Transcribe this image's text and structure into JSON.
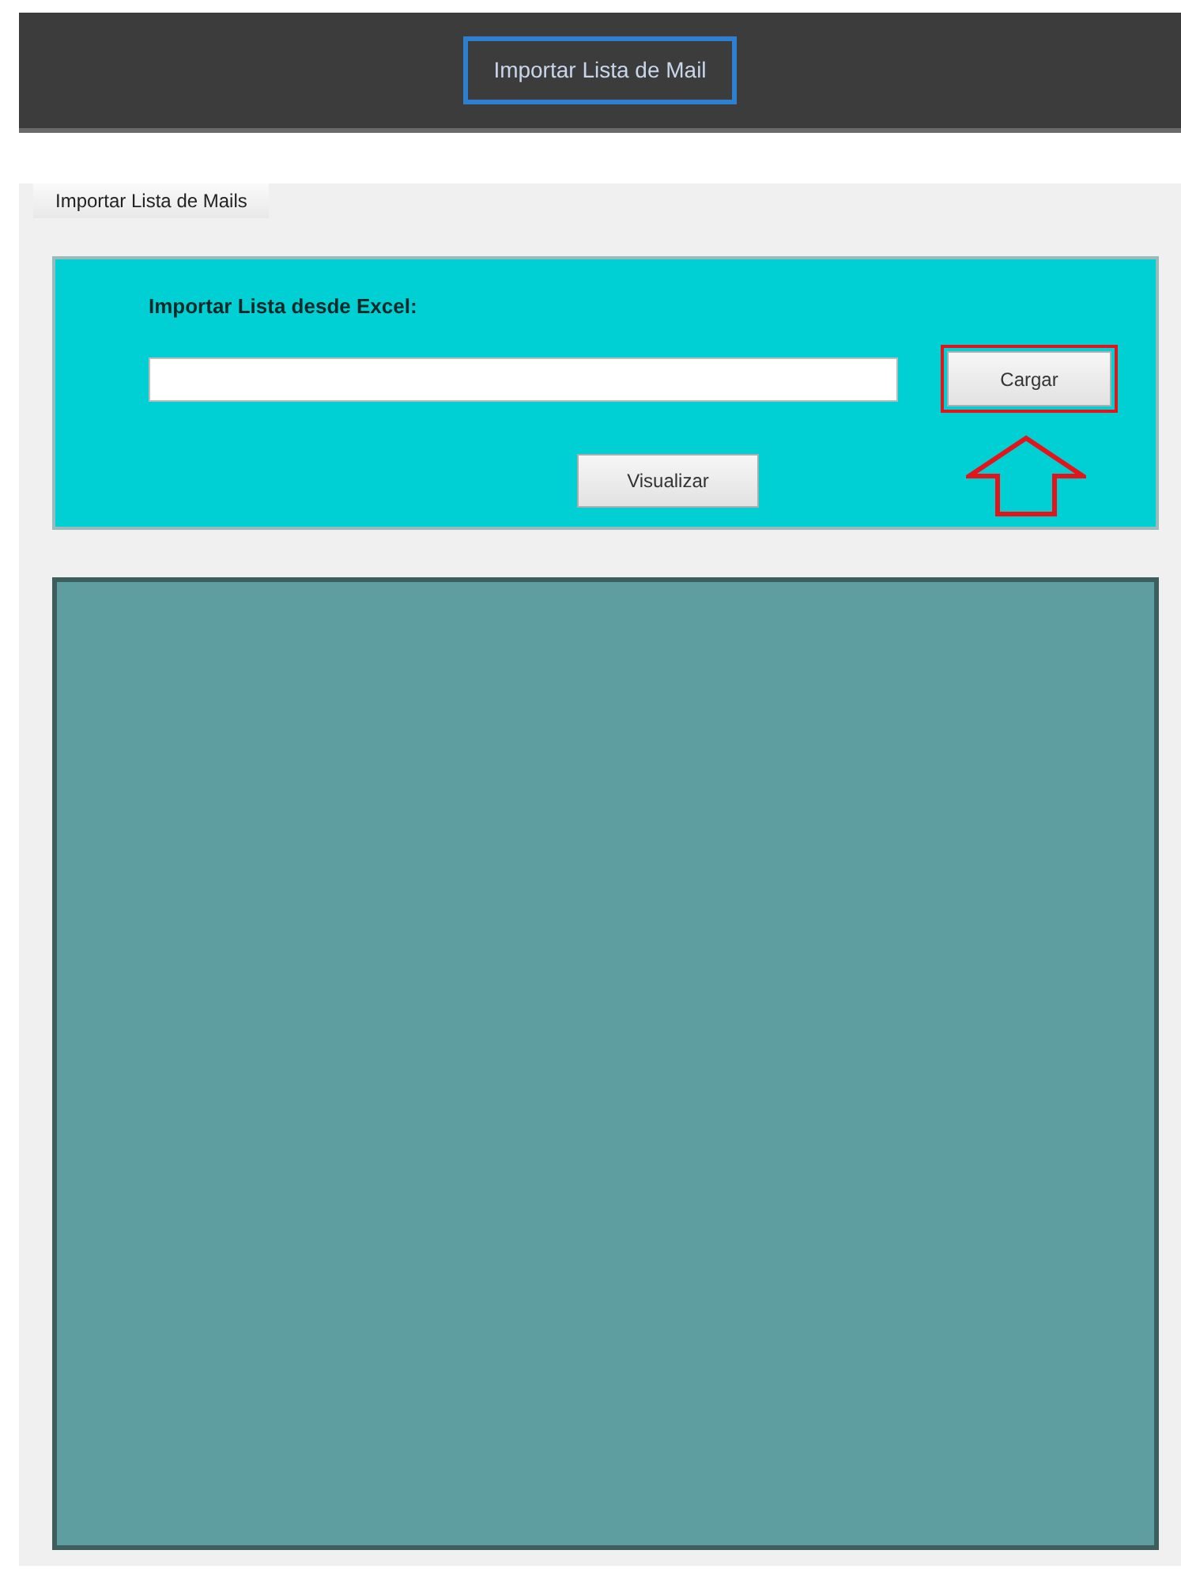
{
  "header": {
    "button": {
      "label": "Importar Lista de Mail",
      "focused": true
    }
  },
  "group": {
    "legend": "Importar Lista de Mails"
  },
  "import_panel": {
    "label": "Importar Lista desde Excel:",
    "buttons": [
      {
        "label": "Cargar",
        "highlighted": true
      },
      {
        "label": "Visualizar",
        "highlighted": false
      }
    ]
  },
  "data_grid": {
    "kind": "empty"
  }
}
